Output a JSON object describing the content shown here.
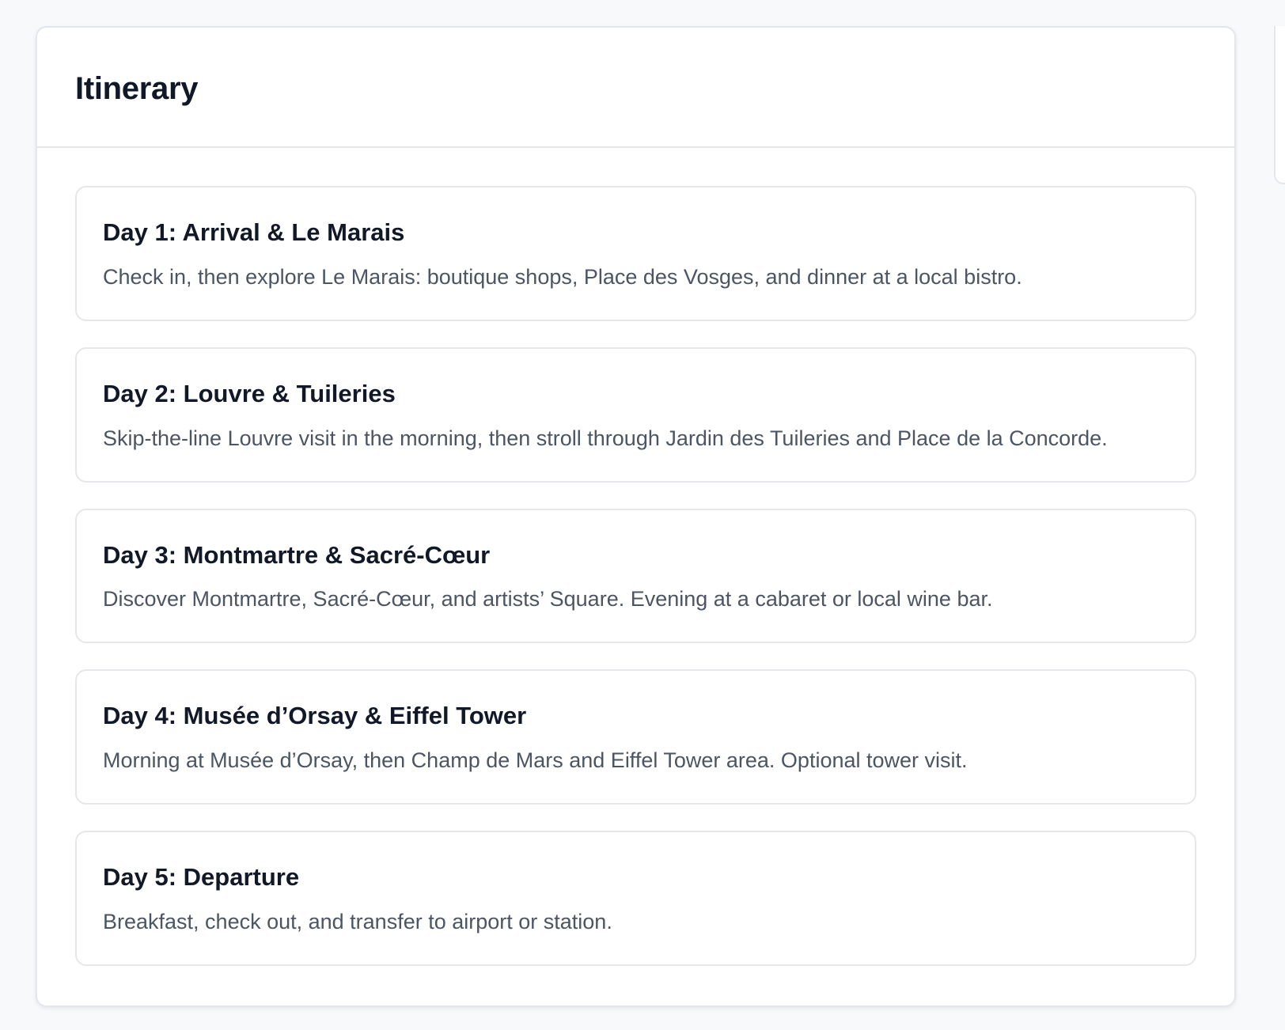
{
  "panel": {
    "title": "Itinerary"
  },
  "days": [
    {
      "title": "Day 1: Arrival & Le Marais",
      "description": "Check in, then explore Le Marais: boutique shops, Place des Vosges, and dinner at a local bistro."
    },
    {
      "title": "Day 2: Louvre & Tuileries",
      "description": "Skip-the-line Louvre visit in the morning, then stroll through Jardin des Tuileries and Place de la Concorde."
    },
    {
      "title": "Day 3: Montmartre & Sacré-Cœur",
      "description": "Discover Montmartre, Sacré-Cœur, and artists’ Square. Evening at a cabaret or local wine bar."
    },
    {
      "title": "Day 4: Musée d’Orsay & Eiffel Tower",
      "description": "Morning at Musée d’Orsay, then Champ de Mars and Eiffel Tower area. Optional tower visit."
    },
    {
      "title": "Day 5: Departure",
      "description": "Breakfast, check out, and transfer to airport or station."
    }
  ],
  "colors": {
    "background": "#f8f9fb",
    "card": "#ffffff",
    "border": "#e5e7eb",
    "title": "#111827",
    "body_text": "#4b5563"
  }
}
